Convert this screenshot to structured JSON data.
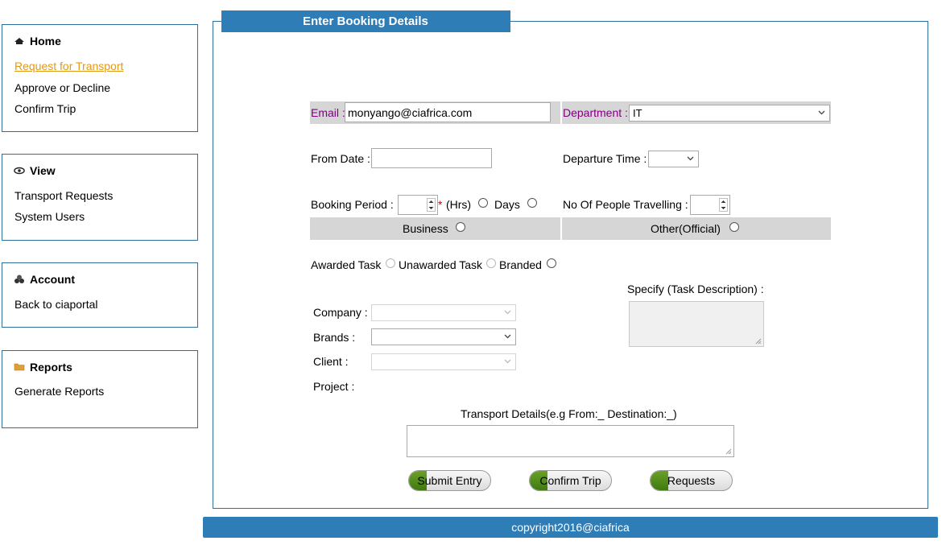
{
  "sidebar": {
    "home": {
      "title": "Home",
      "links": [
        "Request for Transport",
        "Approve or Decline",
        "Confirm Trip"
      ]
    },
    "view": {
      "title": "View",
      "links": [
        "Transport Requests",
        "System Users"
      ]
    },
    "account": {
      "title": "Account",
      "links": [
        "Back to ciaportal"
      ]
    },
    "reports": {
      "title": "Reports",
      "links": [
        "Generate Reports"
      ]
    }
  },
  "form": {
    "tab_title": "Enter Booking Details",
    "email_label": "Email :",
    "email_value": "monyango@ciafrica.com",
    "department_label": "Department :",
    "department_value": "IT",
    "from_date_label": "From Date :",
    "departure_time_label": "Departure Time :",
    "booking_period_label": "Booking Period :",
    "required_star": "*",
    "hrs_label": "(Hrs)",
    "days_label": "Days",
    "people_label": "No Of People Travelling :",
    "business_label": "Business",
    "other_label": "Other(Official)",
    "awarded_label": "Awarded Task",
    "unawarded_label": "Unawarded Task",
    "branded_label": "Branded",
    "specify_label": "Specify (Task Description) :",
    "company_label": "Company :",
    "brands_label": "Brands :",
    "client_label": "Client :",
    "project_label": "Project :",
    "transport_label": "Transport Details(e.g From:_ Destination:_)"
  },
  "buttons": {
    "submit": "Submit Entry",
    "confirm": "Confirm Trip",
    "requests": "Requests"
  },
  "footer": {
    "text": "copyright2016@ciafrica"
  },
  "colors": {
    "brand_blue": "#2f7db7",
    "active_link": "#e39a13",
    "label_purple": "#800080",
    "button_green": "#4f8a18"
  }
}
